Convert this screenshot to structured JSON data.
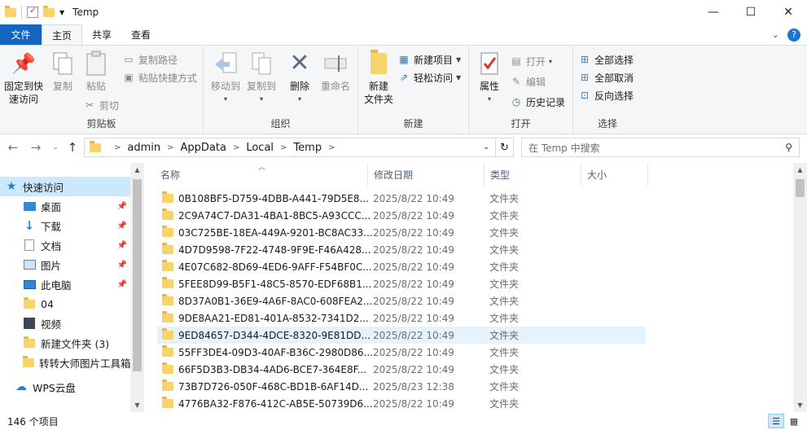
{
  "window": {
    "title": "Temp",
    "minimize": "—",
    "maximize": "☐",
    "close": "✕"
  },
  "tabs": {
    "file": "文件",
    "home": "主页",
    "share": "共享",
    "view": "查看"
  },
  "ribbon": {
    "clipboard": {
      "title": "剪贴板",
      "pin_quick_access": "固定到快\n速访问",
      "copy": "复制",
      "paste": "粘贴",
      "copy_path": "复制路径",
      "paste_shortcut": "粘贴快捷方式",
      "cut": "剪切"
    },
    "organize": {
      "title": "组织",
      "move_to": "移动到",
      "copy_to": "复制到",
      "delete": "删除",
      "rename": "重命名"
    },
    "new": {
      "title": "新建",
      "new_folder": "新建\n文件夹",
      "new_item": "新建项目",
      "easy_access": "轻松访问"
    },
    "open": {
      "title": "打开",
      "properties": "属性",
      "open": "打开",
      "edit": "编辑",
      "history": "历史记录"
    },
    "select": {
      "title": "选择",
      "select_all": "全部选择",
      "select_none": "全部取消",
      "invert": "反向选择"
    }
  },
  "address": {
    "crumbs": [
      "admin",
      "AppData",
      "Local",
      "Temp"
    ],
    "search_placeholder": "在 Temp 中搜索"
  },
  "nav": {
    "items": [
      {
        "label": "快速访问",
        "icon": "star-icon"
      },
      {
        "label": "桌面",
        "icon": "desktop-icon",
        "pinned": true
      },
      {
        "label": "下载",
        "icon": "download-icon",
        "pinned": true
      },
      {
        "label": "文档",
        "icon": "document-icon",
        "pinned": true
      },
      {
        "label": "图片",
        "icon": "picture-icon",
        "pinned": true
      },
      {
        "label": "此电脑",
        "icon": "computer-icon",
        "pinned": true
      },
      {
        "label": "04",
        "icon": "folder-icon"
      },
      {
        "label": "视频",
        "icon": "video-icon"
      },
      {
        "label": "新建文件夹 (3)",
        "icon": "folder-icon"
      },
      {
        "label": "转转大师图片工具箱",
        "icon": "folder-icon"
      },
      {
        "label": "WPS云盘",
        "icon": "cloud-icon"
      }
    ]
  },
  "list": {
    "columns": {
      "name": "名称",
      "date": "修改日期",
      "type": "类型",
      "size": "大小"
    },
    "rows": [
      {
        "name": "0B108BF5-D759-4DBB-A441-79D5E8...",
        "date": "2025/8/22 10:49",
        "type": "文件夹"
      },
      {
        "name": "2C9A74C7-DA31-4BA1-8BC5-A93CCC...",
        "date": "2025/8/22 10:49",
        "type": "文件夹"
      },
      {
        "name": "03C725BE-18EA-449A-9201-BC8AC33...",
        "date": "2025/8/22 10:49",
        "type": "文件夹"
      },
      {
        "name": "4D7D9598-7F22-4748-9F9E-F46A428...",
        "date": "2025/8/22 10:49",
        "type": "文件夹"
      },
      {
        "name": "4E07C682-8D69-4ED6-9AFF-F54BF0C...",
        "date": "2025/8/22 10:49",
        "type": "文件夹"
      },
      {
        "name": "5FEE8D99-B5F1-48C5-8570-EDF68B1...",
        "date": "2025/8/22 10:49",
        "type": "文件夹"
      },
      {
        "name": "8D37A0B1-36E9-4A6F-8AC0-608FEA2...",
        "date": "2025/8/22 10:49",
        "type": "文件夹"
      },
      {
        "name": "9DE8AA21-ED81-401A-8532-7341D2...",
        "date": "2025/8/22 10:49",
        "type": "文件夹"
      },
      {
        "name": "9ED84657-D344-4DCE-8320-9E81DD...",
        "date": "2025/8/22 10:49",
        "type": "文件夹",
        "hover": true
      },
      {
        "name": "55FF3DE4-09D3-40AF-B36C-2980D86...",
        "date": "2025/8/22 10:49",
        "type": "文件夹"
      },
      {
        "name": "66F5D3B3-DB34-4AD6-BCE7-364E8F...",
        "date": "2025/8/22 10:49",
        "type": "文件夹"
      },
      {
        "name": "73B7D726-050F-468C-BD1B-6AF14D...",
        "date": "2025/8/23 12:38",
        "type": "文件夹"
      },
      {
        "name": "4776BA32-F876-412C-AB5E-50739D6...",
        "date": "2025/8/22 10:49",
        "type": "文件夹"
      }
    ]
  },
  "status": {
    "count": "146 个项目"
  },
  "colors": {
    "file_tab": "#1565c0",
    "selection": "#cce8ff",
    "hover": "#e5f3ff",
    "folder": "#f7d36b"
  }
}
